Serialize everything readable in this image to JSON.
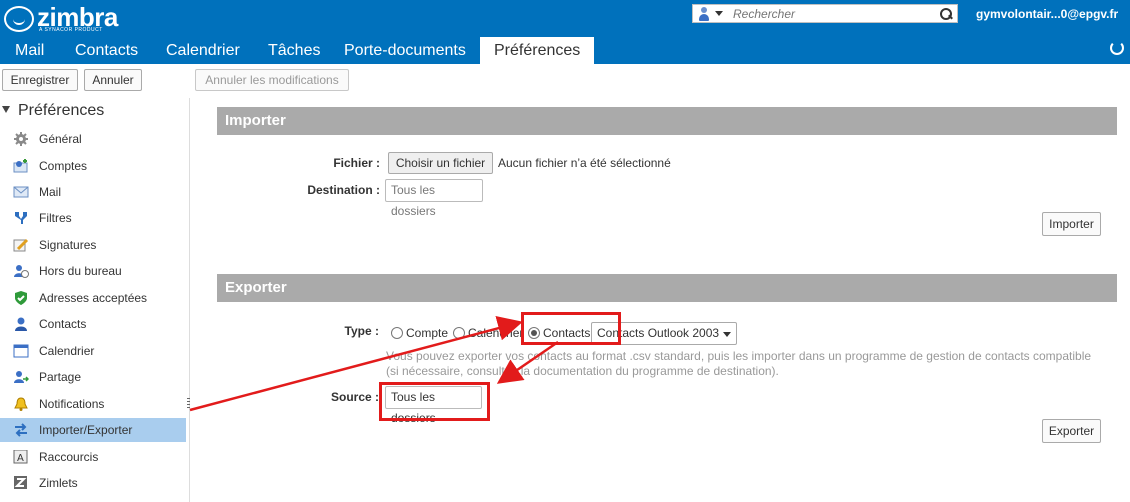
{
  "app": {
    "logo": "zimbra",
    "logo_sub": "A SYNACOR PRODUCT",
    "user": "gymvolontair...0@epgv.fr"
  },
  "search": {
    "placeholder": "Rechercher"
  },
  "tabs": [
    {
      "label": "Mail"
    },
    {
      "label": "Contacts"
    },
    {
      "label": "Calendrier"
    },
    {
      "label": "Tâches"
    },
    {
      "label": "Porte-documents"
    },
    {
      "label": "Préférences",
      "active": true
    }
  ],
  "toolbar": {
    "save": "Enregistrer",
    "cancel": "Annuler",
    "undo": "Annuler les modifications"
  },
  "sidebar": {
    "title": "Préférences",
    "items": [
      {
        "label": "Général",
        "icon": "gear-icon"
      },
      {
        "label": "Comptes",
        "icon": "accounts-icon"
      },
      {
        "label": "Mail",
        "icon": "envelope-icon"
      },
      {
        "label": "Filtres",
        "icon": "filter-icon"
      },
      {
        "label": "Signatures",
        "icon": "signature-icon"
      },
      {
        "label": "Hors du bureau",
        "icon": "out-of-office-icon"
      },
      {
        "label": "Adresses acceptées",
        "icon": "shield-check-icon"
      },
      {
        "label": "Contacts",
        "icon": "contact-icon"
      },
      {
        "label": "Calendrier",
        "icon": "calendar-icon"
      },
      {
        "label": "Partage",
        "icon": "share-icon"
      },
      {
        "label": "Notifications",
        "icon": "bell-icon"
      },
      {
        "label": "Importer/Exporter",
        "icon": "import-export-icon",
        "selected": true
      },
      {
        "label": "Raccourcis",
        "icon": "keyboard-icon"
      },
      {
        "label": "Zimlets",
        "icon": "zimlet-icon"
      }
    ]
  },
  "import": {
    "title": "Importer",
    "file_label": "Fichier :",
    "file_button": "Choisir un fichier",
    "file_status": "Aucun fichier n’a été sélectionné",
    "dest_label": "Destination :",
    "dest_value": "Tous les dossiers",
    "button": "Importer"
  },
  "export": {
    "title": "Exporter",
    "type_label": "Type :",
    "types": [
      {
        "label": "Compte",
        "selected": false
      },
      {
        "label": "Calendrier",
        "selected": false
      },
      {
        "label": "Contacts",
        "selected": true
      }
    ],
    "format": "Contacts Outlook 2003",
    "hint_line1": "Vous pouvez exporter vos contacts au format .csv standard, puis les importer dans un programme de gestion de contacts compatible",
    "hint_line2": "(si nécessaire, consultez la documentation du programme de destination).",
    "source_label": "Source :",
    "source_value": "Tous les dossiers",
    "button": "Exporter"
  },
  "colors": {
    "brand": "#0071bc",
    "highlight": "#e21b1b",
    "section": "#aaaaaa",
    "selected": "#a9cdee"
  }
}
